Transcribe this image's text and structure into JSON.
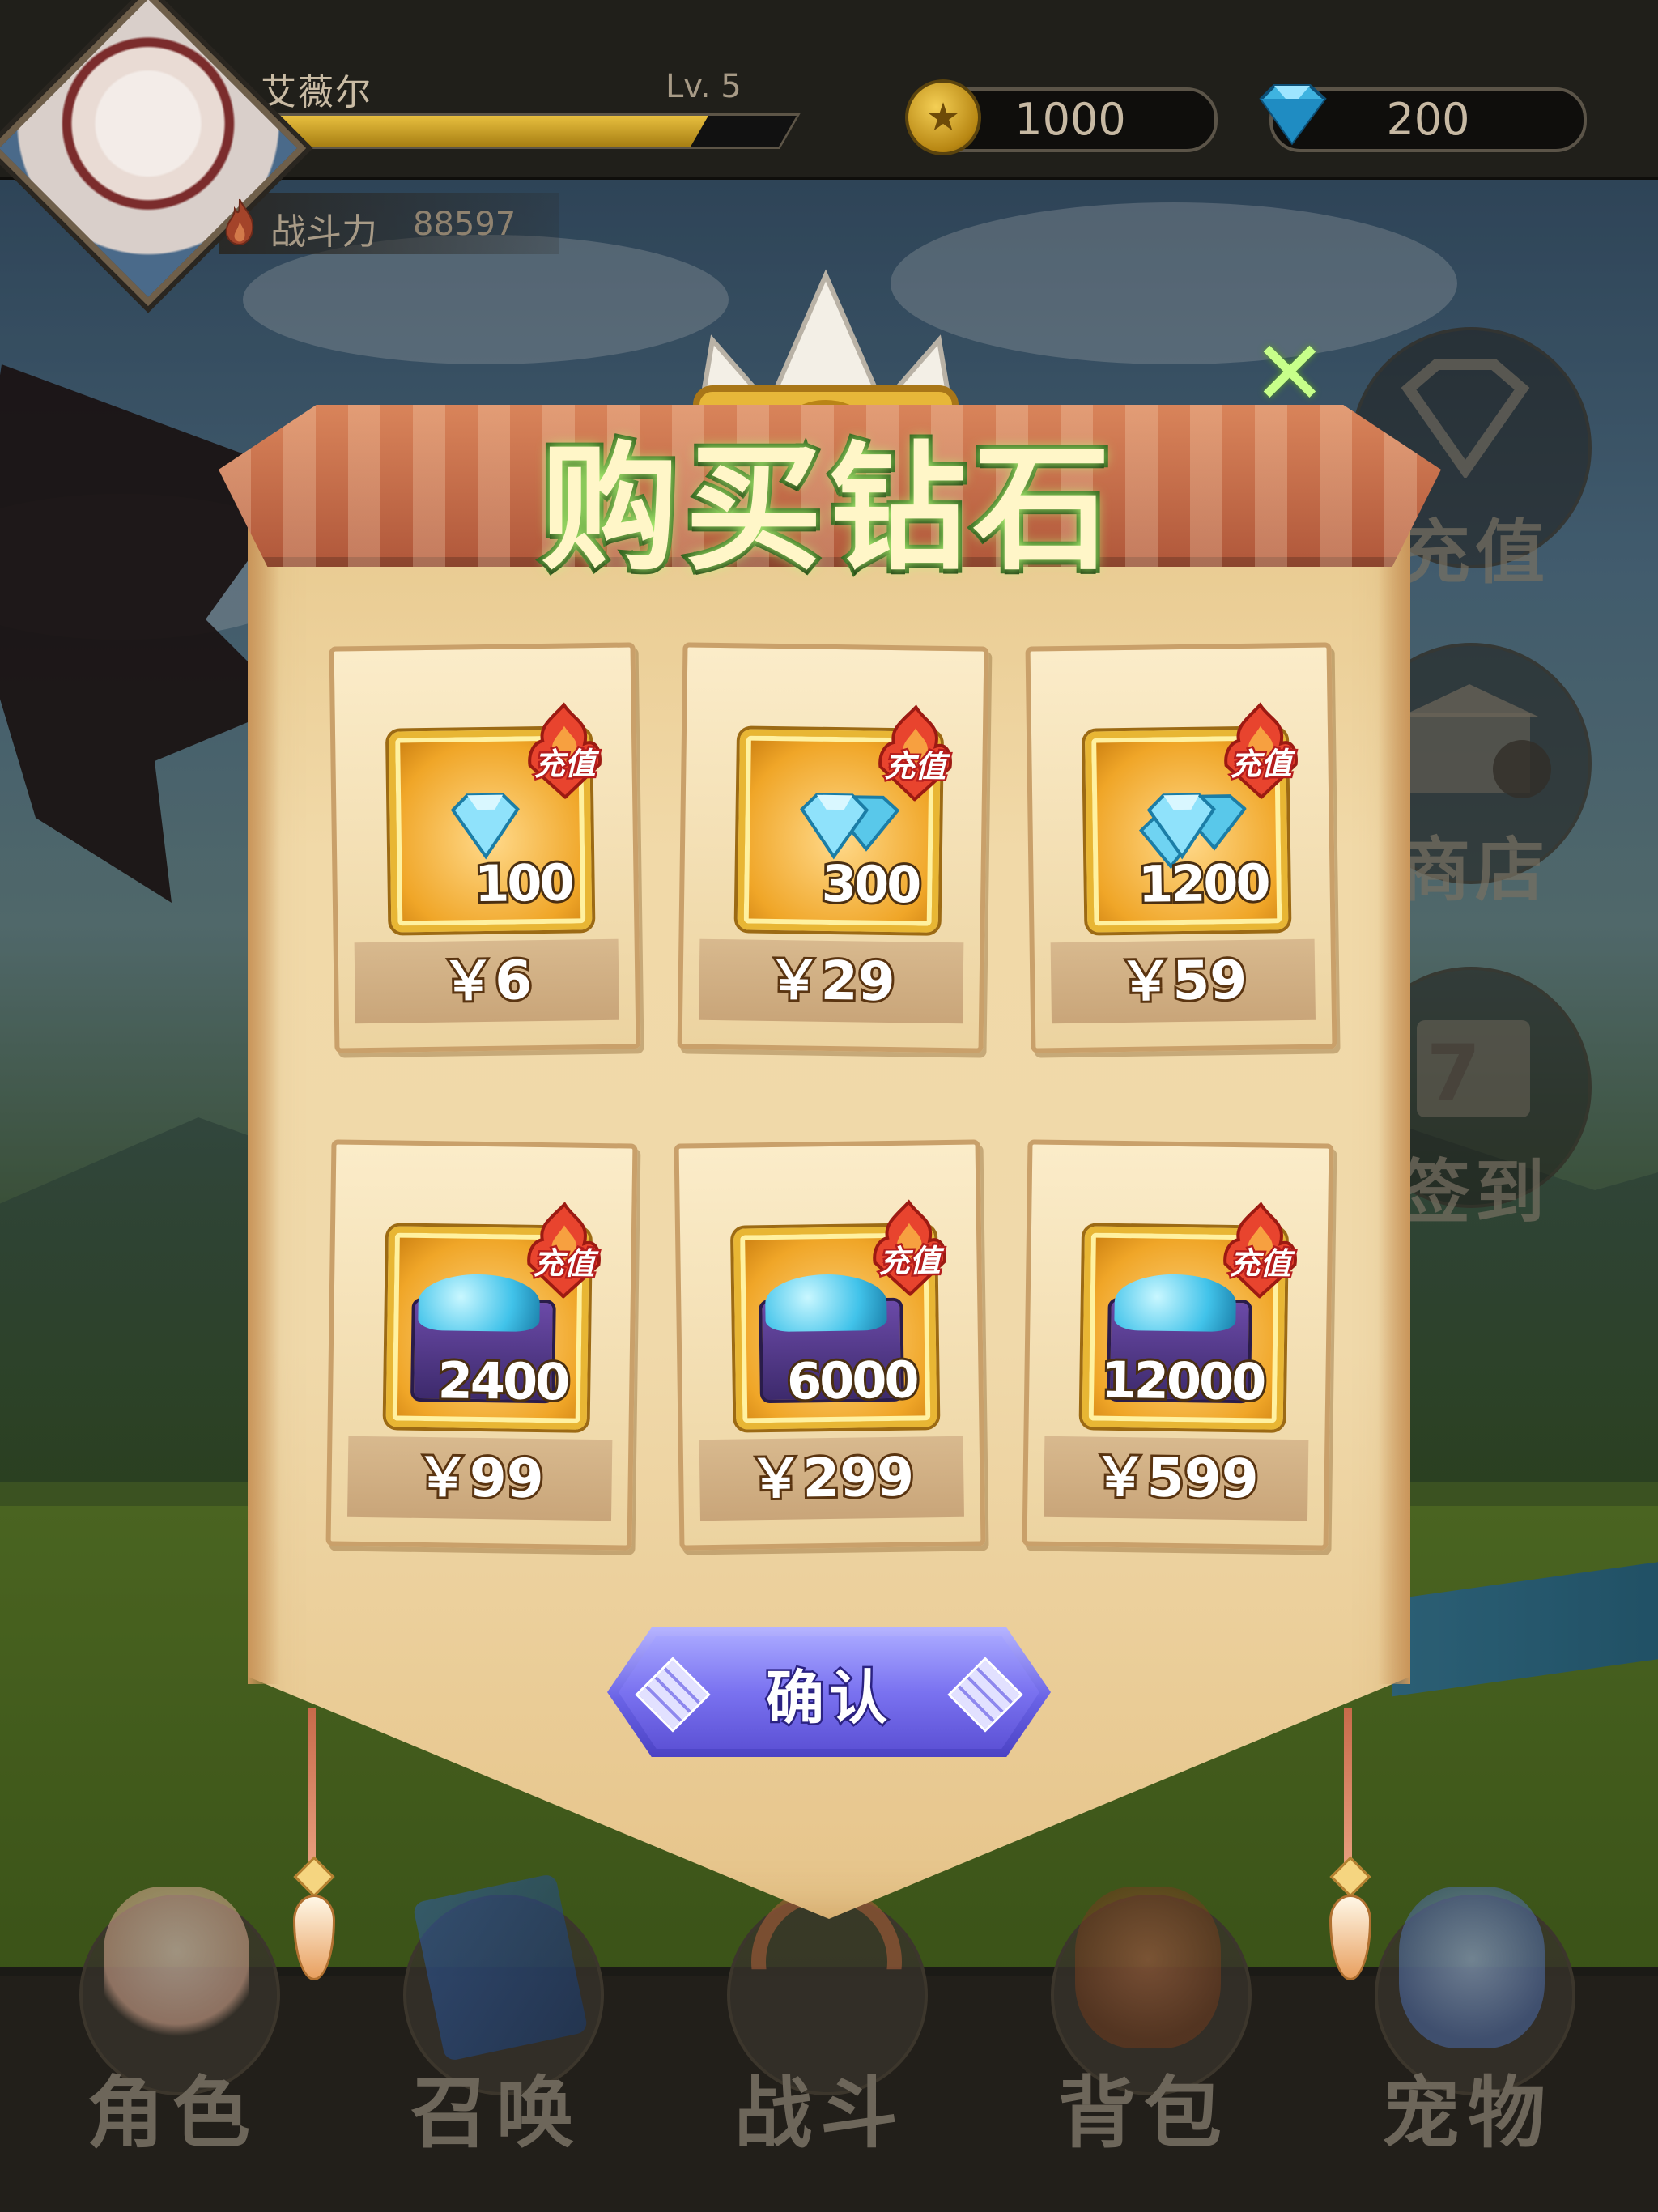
{
  "player": {
    "name": "艾薇尔",
    "level": "Lv. 5",
    "xp_fraction": 0.83,
    "power_label": "战斗力",
    "power_value": "88597"
  },
  "resources": {
    "coins": "1000",
    "gems": "200"
  },
  "side_menu": {
    "recharge": "充值",
    "shop": "商店",
    "checkin": "签到",
    "checkin_day": "7"
  },
  "dialog": {
    "title": "购买钻石",
    "close_icon": "✕",
    "confirm": "确认",
    "badge_text": "充值",
    "packs": [
      {
        "amount": "100",
        "price": "￥6"
      },
      {
        "amount": "300",
        "price": "￥29"
      },
      {
        "amount": "1200",
        "price": "￥59"
      },
      {
        "amount": "2400",
        "price": "￥99"
      },
      {
        "amount": "6000",
        "price": "￥299"
      },
      {
        "amount": "12000",
        "price": "￥599"
      }
    ]
  },
  "bottom_nav": [
    {
      "label": "角色",
      "icon": "character-icon"
    },
    {
      "label": "召唤",
      "icon": "summon-book-icon"
    },
    {
      "label": "战斗",
      "icon": "battle-bow-icon"
    },
    {
      "label": "背包",
      "icon": "backpack-icon"
    },
    {
      "label": "宠物",
      "icon": "pet-owl-icon"
    }
  ],
  "colors": {
    "title_glow": "#b9ff7a",
    "confirm_button": "#6a63e6",
    "hot_badge": "#d8382a",
    "card_frame_gold": "#e8b634"
  }
}
